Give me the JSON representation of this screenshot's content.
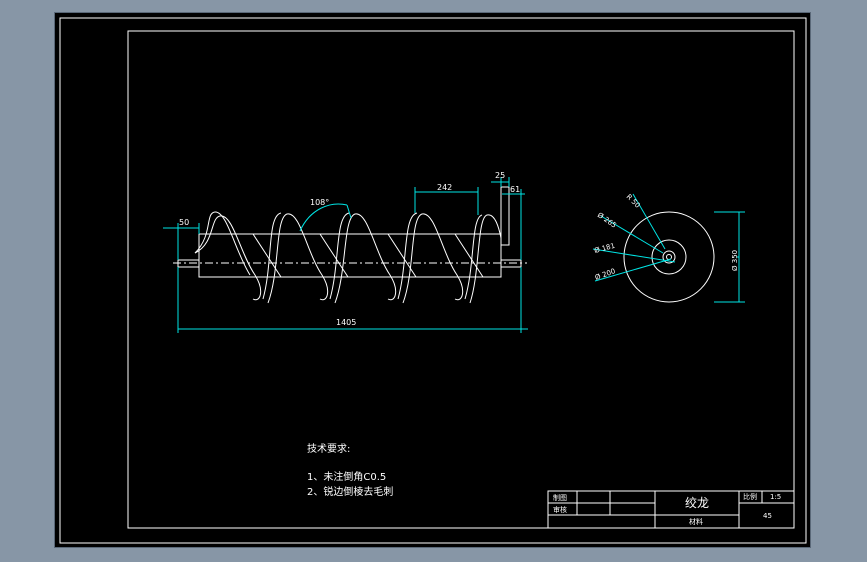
{
  "drawing": {
    "dimensions": {
      "left_shaft": "50",
      "helix_angle": "108°",
      "pitch": "242",
      "flange": "25",
      "shaft_end": "61",
      "total_length": "1405",
      "d_r50": "R 50",
      "d_265": "Ø 265",
      "d_181": "Ø 181",
      "d_200": "Ø 200",
      "d_350": "Ø 350"
    },
    "notes": {
      "title": "技术要求:",
      "line1": "1、未注倒角C0.5",
      "line2": "2、锐边倒棱去毛刺"
    },
    "title_block": {
      "drawn_label": "制图",
      "checked_label": "审核",
      "part_name": "绞龙",
      "scale_label": "比例",
      "scale_value": "1:5",
      "material_label": "材料",
      "material_value": "45"
    }
  },
  "colors": {
    "background": "#000000",
    "line": "#ffffff",
    "dimension": "#00e5e5",
    "window": "#8796a6"
  }
}
